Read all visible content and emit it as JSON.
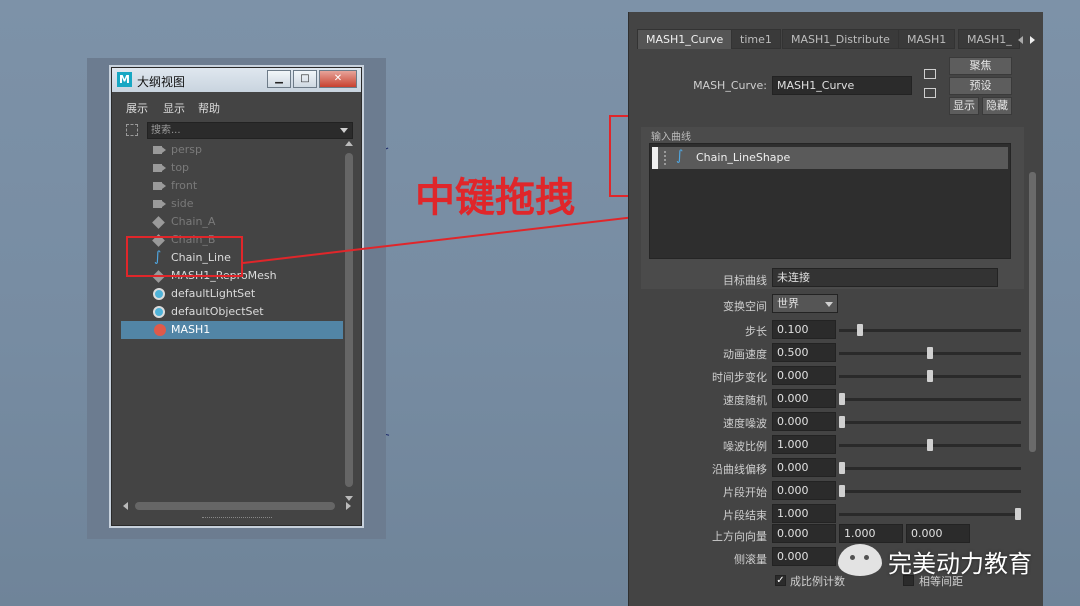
{
  "outliner": {
    "title": "大纲视图",
    "window_buttons": [
      "▁",
      "□",
      "✕"
    ],
    "menu": [
      "展示",
      "显示",
      "帮助"
    ],
    "search_placeholder": "搜索...",
    "items": [
      {
        "label": "persp",
        "icon": "camera-icon",
        "dim": true
      },
      {
        "label": "top",
        "icon": "camera-icon",
        "dim": true
      },
      {
        "label": "front",
        "icon": "camera-icon",
        "dim": true
      },
      {
        "label": "side",
        "icon": "camera-icon",
        "dim": true
      },
      {
        "label": "Chain_A",
        "icon": "mesh-icon",
        "dim": true
      },
      {
        "label": "Chain_B",
        "icon": "mesh-icon",
        "dim": true
      },
      {
        "label": "Chain_Line",
        "icon": "curve-icon",
        "dim": false
      },
      {
        "label": "MASH1_ReproMesh",
        "icon": "mesh-icon",
        "dim": false
      },
      {
        "label": "defaultLightSet",
        "icon": "set-icon",
        "dim": false
      },
      {
        "label": "defaultObjectSet",
        "icon": "set-icon",
        "dim": false
      },
      {
        "label": "MASH1",
        "icon": "mash-icon",
        "dim": false,
        "selected": true
      }
    ]
  },
  "annotation": {
    "text": "中键拖拽",
    "color": "#e0262a"
  },
  "attribute_editor": {
    "tabs": [
      "MASH1_Curve",
      "time1",
      "MASH1_Distribute",
      "MASH1",
      "MASH1_"
    ],
    "active_tab": "MASH1_Curve",
    "node_label": "MASH_Curve:",
    "node_value": "MASH1_Curve",
    "buttons": {
      "focus": "聚焦",
      "presets": "预设",
      "show": "显示",
      "hide": "隐藏"
    },
    "input_curves": {
      "title": "输入曲线",
      "items": [
        "Chain_LineShape"
      ]
    },
    "target_curve": {
      "label": "目标曲线",
      "value": "未连接"
    },
    "transform_space": {
      "label": "变换空间",
      "value": "世界"
    },
    "sliders": [
      {
        "label": "步长",
        "value": "0.100",
        "fraction": 0.1
      },
      {
        "label": "动画速度",
        "value": "0.500",
        "fraction": 0.5
      },
      {
        "label": "时间步变化",
        "value": "0.000",
        "fraction": 0.5
      },
      {
        "label": "速度随机",
        "value": "0.000",
        "fraction": 0.0
      },
      {
        "label": "速度噪波",
        "value": "0.000",
        "fraction": 0.0
      },
      {
        "label": "噪波比例",
        "value": "1.000",
        "fraction": 0.5
      },
      {
        "label": "沿曲线偏移",
        "value": "0.000",
        "fraction": 0.0
      },
      {
        "label": "片段开始",
        "value": "0.000",
        "fraction": 0.0
      },
      {
        "label": "片段结束",
        "value": "1.000",
        "fraction": 1.0
      }
    ],
    "up_vector": {
      "label": "上方向向量",
      "values": [
        "0.000",
        "1.000",
        "0.000"
      ]
    },
    "roll": {
      "label": "侧滚量",
      "value": "0.000"
    },
    "checkboxes": [
      {
        "label": "成比例计数",
        "checked": true
      },
      {
        "label": "相等间距",
        "checked": false
      }
    ]
  },
  "watermark": {
    "text": "完美动力教育"
  }
}
